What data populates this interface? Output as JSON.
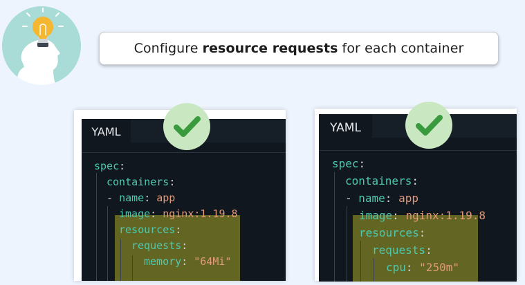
{
  "banner": {
    "prefix": "Configure",
    "emphasis": "resource requests",
    "suffix": "for each container"
  },
  "icons": {
    "badge": "lightbulb-head-icon",
    "check": "checkmark-icon"
  },
  "colors": {
    "background": "#edf4fd",
    "badge": "#a9dcd6",
    "editor": "#10171e",
    "key": "#4ec9b0",
    "value": "#e39a7c",
    "highlight": "#d7d228",
    "check_circle": "#c9e8c2",
    "check_mark": "#3a9b3e"
  },
  "panels": [
    {
      "tab": "YAML",
      "lines": [
        {
          "key": "spec",
          "sep": ":",
          "value": ""
        },
        {
          "key": "containers",
          "sep": ":",
          "value": ""
        },
        {
          "dash": "- ",
          "key": "name",
          "sep": ": ",
          "value": "app"
        },
        {
          "key": "image",
          "sep": ": ",
          "value": "nginx:1.19.8"
        },
        {
          "key": "resources",
          "sep": ":",
          "value": ""
        },
        {
          "key": "requests",
          "sep": ":",
          "value": ""
        },
        {
          "key": "memory",
          "sep": ": ",
          "value": "\"64Mi\""
        }
      ]
    },
    {
      "tab": "YAML",
      "lines": [
        {
          "key": "spec",
          "sep": ":",
          "value": ""
        },
        {
          "key": "containers",
          "sep": ":",
          "value": ""
        },
        {
          "dash": "- ",
          "key": "name",
          "sep": ": ",
          "value": "app"
        },
        {
          "key": "image",
          "sep": ": ",
          "value": "nginx:1.19.8"
        },
        {
          "key": "resources",
          "sep": ":",
          "value": ""
        },
        {
          "key": "requests",
          "sep": ":",
          "value": ""
        },
        {
          "key": "cpu",
          "sep": ": ",
          "value": "\"250m\""
        }
      ]
    }
  ]
}
